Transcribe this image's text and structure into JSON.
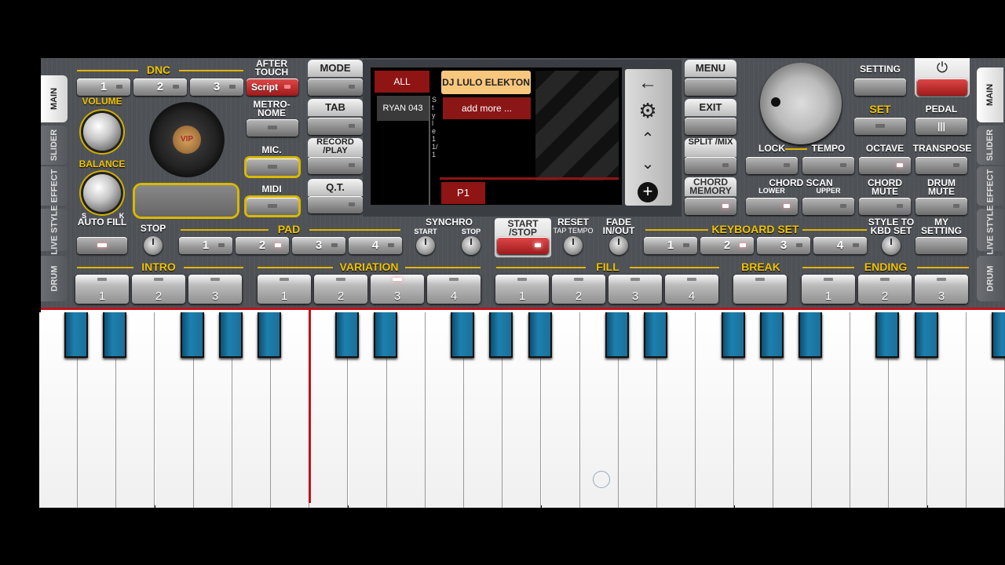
{
  "dnc": {
    "title": "DNC",
    "buttons": [
      "1",
      "2",
      "3"
    ],
    "script": "Script"
  },
  "after_touch": "AFTER TOUCH",
  "volume": "VOLUME",
  "balance": "BALANCE",
  "balance_s": "S",
  "balance_k": "K",
  "metronome": "METRO- NOME",
  "mic": "MIC.",
  "midi": "MIDI",
  "mode": "MODE",
  "tab": "TAB",
  "record_play": "RECORD /PLAY",
  "qt": "Q.T.",
  "display": {
    "all": "ALL",
    "style_name": "RYAN 043",
    "side_text": "S t y l e 1 1/1",
    "selected_style": "DJ LULO ELEKTON",
    "add_more": "add more ...",
    "page": "P1"
  },
  "menu": "MENU",
  "exit": "EXIT",
  "split_mix": "SPLIT /MIX",
  "chord_memory": "CHORD MEMORY",
  "setting": "SETTING",
  "set": "SET",
  "pedal": "PEDAL",
  "lock": "LOCK",
  "tempo": "TEMPO",
  "octave": "OCTAVE",
  "transpose": "TRANSPOSE",
  "chord_scan": "CHORD SCAN",
  "lower": "LOWER",
  "upper": "UPPER",
  "chord_mute": "CHORD MUTE",
  "drum_mute": "DRUM MUTE",
  "auto_fill": "AUTO FILL",
  "stop": "STOP",
  "pad": {
    "title": "PAD",
    "buttons": [
      "1",
      "2",
      "3",
      "4"
    ]
  },
  "synchro": "SYNCHRO",
  "synchro_start": "START",
  "synchro_stop": "STOP",
  "start_stop": "START /STOP",
  "reset": "RESET",
  "tap_tempo": "TAP TEMPO",
  "fade": "FADE IN/OUT",
  "keyboard_set": {
    "title": "KEYBOARD SET",
    "buttons": [
      "1",
      "2",
      "3",
      "4"
    ]
  },
  "style_to_kbd": "STYLE TO KBD SET",
  "my_setting": "MY SETTING",
  "intro": {
    "title": "INTRO",
    "buttons": [
      "1",
      "2",
      "3"
    ]
  },
  "variation": {
    "title": "VARIATION",
    "buttons": [
      "1",
      "2",
      "3",
      "4"
    ]
  },
  "fill": {
    "title": "FILL",
    "buttons": [
      "1",
      "2",
      "3",
      "4"
    ]
  },
  "break": "BREAK",
  "ending": {
    "title": "ENDING",
    "buttons": [
      "1",
      "2",
      "3"
    ]
  },
  "side_tabs": [
    "MAIN",
    "SLIDER",
    "EFFECT",
    "LIVE STYLE",
    "DRUM"
  ],
  "logo_text": "VIP"
}
